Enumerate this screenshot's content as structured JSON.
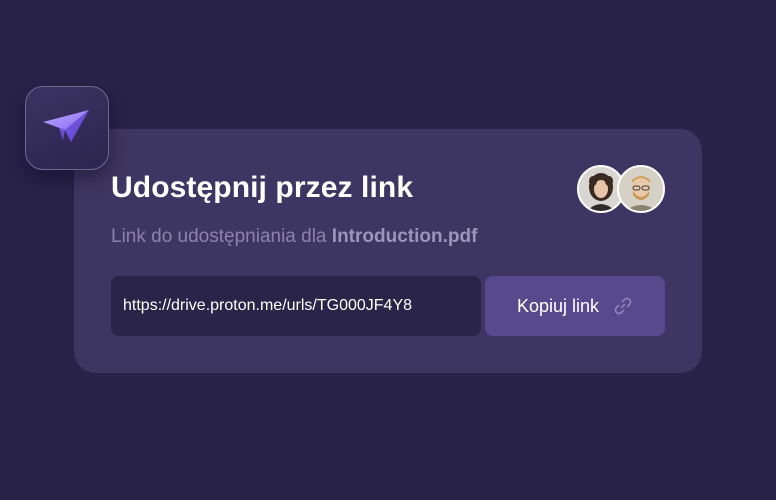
{
  "share": {
    "title": "Udostępnij przez link",
    "subtitle_prefix": "Link do udostępniania dla ",
    "file_name": "Introduction.pdf",
    "url": "https://drive.proton.me/urls/TG000JF4Y8",
    "copy_label": "Kopiuj link"
  },
  "icons": {
    "app": "paper-plane-icon",
    "copy": "link-icon"
  },
  "colors": {
    "background": "#292249",
    "card": "#3e3662",
    "field": "#2a2449",
    "button": "#574a8c",
    "accent": "#8f78f5"
  }
}
